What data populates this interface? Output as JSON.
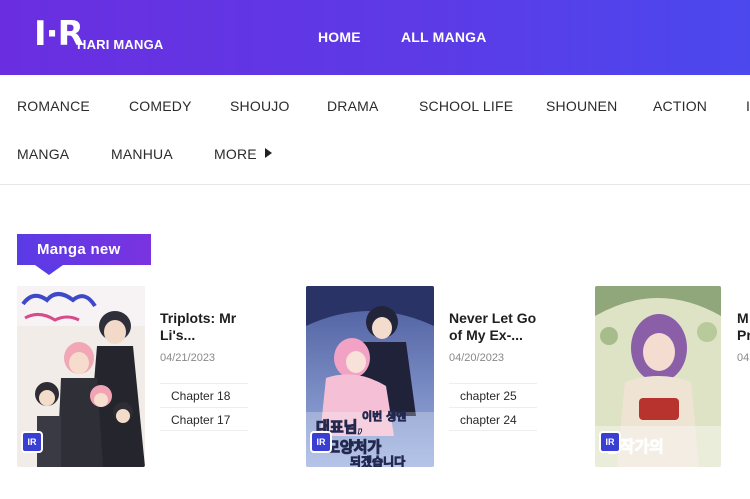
{
  "header": {
    "logo_mark": "I·R",
    "logo_text": "HARI MANGA",
    "nav": [
      "HOME",
      "ALL MANGA"
    ]
  },
  "genres": {
    "row1": [
      "ROMANCE",
      "COMEDY",
      "SHOUJO",
      "DRAMA",
      "SCHOOL LIFE",
      "SHOUNEN",
      "ACTION",
      "I"
    ],
    "row2": [
      "MANGA",
      "MANHUA",
      "MORE"
    ]
  },
  "section": {
    "title": "Manga new"
  },
  "cards": [
    {
      "title_line1": "Triplots: Mr",
      "title_line2": "Li's...",
      "date": "04/21/2023",
      "chapters": [
        "Chapter 18",
        "Chapter 17"
      ]
    },
    {
      "title_line1": "Never Let Go",
      "title_line2": "of My Ex-...",
      "date": "04/20/2023",
      "chapters": [
        "chapter 25",
        "chapter 24"
      ]
    },
    {
      "title_line1": "M",
      "title_line2": "Pr",
      "date": "04",
      "chapters": [
        "",
        ""
      ]
    }
  ],
  "colors": {
    "header_start": "#6a2ee0",
    "header_end": "#4b48ee",
    "tag": "#5a3be6"
  }
}
